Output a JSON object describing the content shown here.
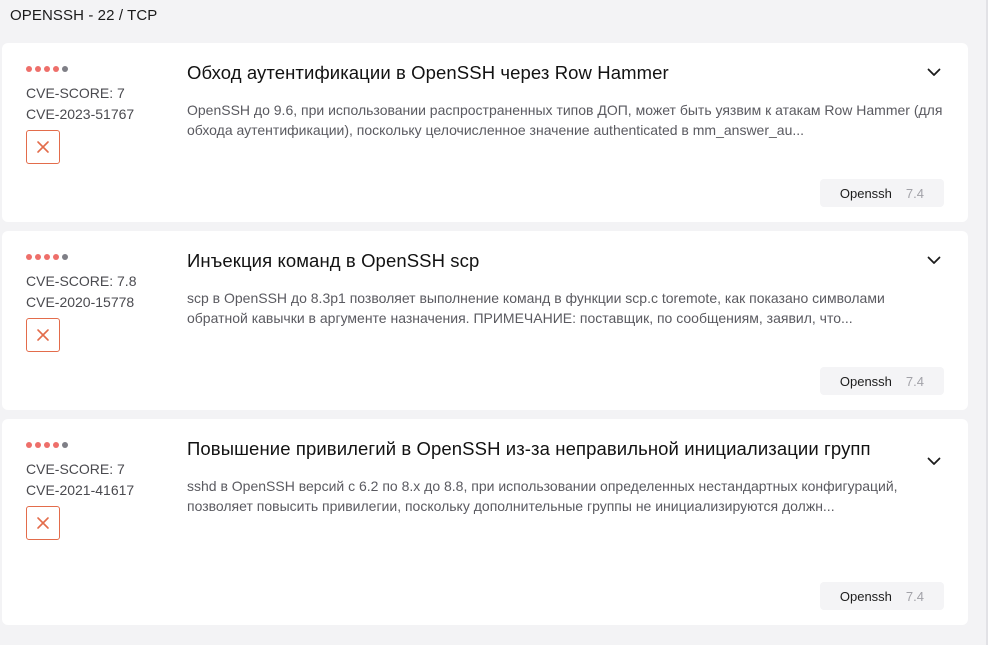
{
  "header": {
    "title": "OPENSSH - 22 / TCP"
  },
  "colors": {
    "severity_active": "#ee6f6a",
    "severity_inactive": "#7f7f86",
    "dismiss_accent": "#e36c4b"
  },
  "cards": [
    {
      "severity_dots": [
        true,
        true,
        true,
        true,
        false
      ],
      "score_label": "CVE-SCORE: 7",
      "cve_id": "CVE-2023-51767",
      "title": "Обход аутентификации в OpenSSH через Row Hammer",
      "description": "OpenSSH до 9.6, при использовании распространенных типов ДОП, может быть уязвим к атакам Row Hammer (для обхода аутентификации), поскольку целочисленное значение authenticated в mm_answer_au...",
      "tag_name": "Openssh",
      "tag_score": "7.4",
      "icons": {
        "dismiss": "close-icon",
        "expand": "chevron-down-icon"
      }
    },
    {
      "severity_dots": [
        true,
        true,
        true,
        true,
        false
      ],
      "score_label": "CVE-SCORE: 7.8",
      "cve_id": "CVE-2020-15778",
      "title": "Инъекция команд в OpenSSH scp",
      "description": "scp в OpenSSH до 8.3p1 позволяет выполнение команд в функции scp.c toremote, как показано символами обратной кавычки в аргументе назначения. ПРИМЕЧАНИЕ: поставщик, по сообщениям, заявил, что...",
      "tag_name": "Openssh",
      "tag_score": "7.4",
      "icons": {
        "dismiss": "close-icon",
        "expand": "chevron-down-icon"
      }
    },
    {
      "severity_dots": [
        true,
        true,
        true,
        true,
        false
      ],
      "score_label": "CVE-SCORE: 7",
      "cve_id": "CVE-2021-41617",
      "title": "Повышение привилегий в OpenSSH из-за неправильной инициализации групп",
      "description": "sshd в OpenSSH версий с 6.2 по 8.x до 8.8, при использовании определенных нестандартных конфигураций, позволяет повысить привилегии, поскольку дополнительные группы не инициализируются должн...",
      "tag_name": "Openssh",
      "tag_score": "7.4",
      "icons": {
        "dismiss": "close-icon",
        "expand": "chevron-down-icon"
      }
    }
  ]
}
